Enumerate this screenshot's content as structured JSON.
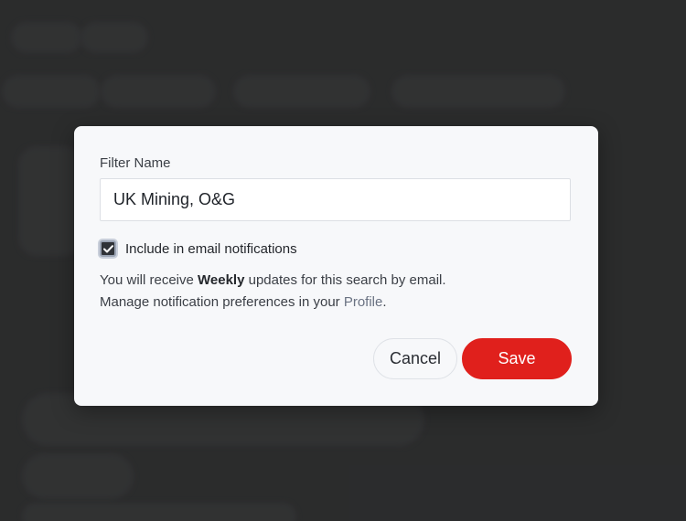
{
  "dialog": {
    "field_label": "Filter Name",
    "filter_name_value": "UK Mining, O&G",
    "checkbox_label": "Include in email notifications",
    "checkbox_checked": true,
    "info_line1_prefix": "You will receive ",
    "info_line1_bold": "Weekly",
    "info_line1_suffix": " updates for this search by email.",
    "info_line2_prefix": "Manage notification preferences in your ",
    "info_line2_link": "Profile",
    "info_line2_suffix": ".",
    "cancel_label": "Cancel",
    "save_label": "Save"
  },
  "colors": {
    "save_button": "#e0201c",
    "overlay": "#333435",
    "modal_background": "#f7f8fa",
    "link": "#6a7282"
  },
  "icons": {
    "checkbox": "checkmark-icon"
  }
}
